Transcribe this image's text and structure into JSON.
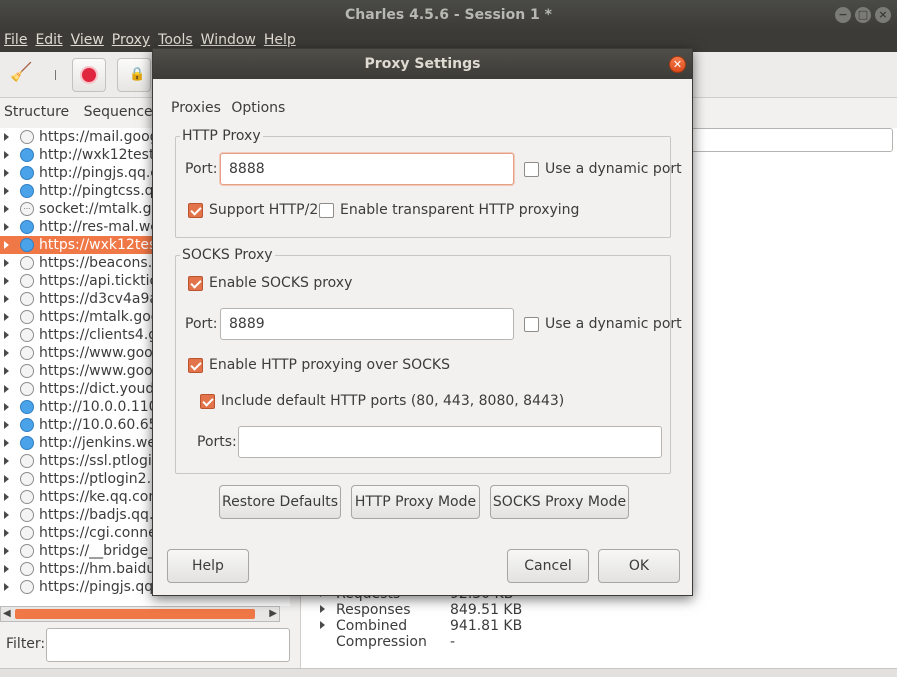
{
  "window": {
    "title": "Charles 4.5.6 - Session 1 *",
    "controls": {
      "minimize": "−",
      "maximize": "□",
      "close": "×"
    }
  },
  "menu": [
    "File",
    "Edit",
    "View",
    "Proxy",
    "Tools",
    "Window",
    "Help"
  ],
  "left_tabs": {
    "structure": "Structure",
    "sequence": "Sequence"
  },
  "tree": [
    {
      "label": "https://mail.google",
      "icon": "globe-icon"
    },
    {
      "label": "http://wxk12test.1",
      "icon": "globe-blue-icon"
    },
    {
      "label": "http://pingjs.qq.co",
      "icon": "globe-blue-icon"
    },
    {
      "label": "http://pingtcss.qq.",
      "icon": "globe-blue-icon"
    },
    {
      "label": "socket://mtalk.goo",
      "icon": "socket-icon"
    },
    {
      "label": "http://res-mal.wed",
      "icon": "globe-blue-icon"
    },
    {
      "label": "https://wxk12test.",
      "icon": "globe-blue-icon",
      "selected": true
    },
    {
      "label": "https://beacons.gc",
      "icon": "globe-icon"
    },
    {
      "label": "https://api.ticktick.c",
      "icon": "globe-icon"
    },
    {
      "label": "https://d3cv4a9a9",
      "icon": "globe-icon"
    },
    {
      "label": "https://mtalk.goog",
      "icon": "globe-icon"
    },
    {
      "label": "https://clients4.goo",
      "icon": "globe-icon"
    },
    {
      "label": "https://www.goog",
      "icon": "globe-icon"
    },
    {
      "label": "https://www.goog",
      "icon": "globe-icon"
    },
    {
      "label": "https://dict.youdac",
      "icon": "globe-icon"
    },
    {
      "label": "http://10.0.0.110:8",
      "icon": "globe-blue-icon"
    },
    {
      "label": "http://10.0.60.65:8",
      "icon": "globe-blue-icon"
    },
    {
      "label": "http://jenkins.weds",
      "icon": "globe-blue-icon"
    },
    {
      "label": "https://ssl.ptlogin2",
      "icon": "globe-icon"
    },
    {
      "label": "https://ptlogin2.ke",
      "icon": "globe-icon"
    },
    {
      "label": "https://ke.qq.com",
      "icon": "globe-icon"
    },
    {
      "label": "https://badjs.qq.co",
      "icon": "globe-icon"
    },
    {
      "label": "https://cgi.connect",
      "icon": "globe-icon"
    },
    {
      "label": "https://__bridge_lc",
      "icon": "globe-icon"
    },
    {
      "label": "https://hm.baidu.cc",
      "icon": "globe-icon"
    },
    {
      "label": "https://pingjs.qq.cc",
      "icon": "globe-icon"
    }
  ],
  "filter": {
    "label": "Filter:",
    "value": ""
  },
  "stats": [
    {
      "name": "Requests",
      "value": "92.30 KB"
    },
    {
      "name": "Responses",
      "value": "849.51 KB"
    },
    {
      "name": "Combined",
      "value": "941.81 KB"
    },
    {
      "name": "Compression",
      "value": "-"
    }
  ],
  "dialog": {
    "title": "Proxy Settings",
    "tabs": [
      "Proxies",
      "Options"
    ],
    "http_proxy": {
      "legend": "HTTP Proxy",
      "port_label": "Port:",
      "port_value": "8888",
      "dynamic_port_label": "Use a dynamic port",
      "dynamic_port_checked": false,
      "support_http2_label": "Support HTTP/2",
      "support_http2_checked": true,
      "transparent_label": "Enable transparent HTTP proxying",
      "transparent_checked": false
    },
    "socks_proxy": {
      "legend": "SOCKS Proxy",
      "enable_label": "Enable SOCKS proxy",
      "enable_checked": true,
      "port_label": "Port:",
      "port_value": "8889",
      "dynamic_port_label": "Use a dynamic port",
      "dynamic_port_checked": false,
      "http_over_socks_label": "Enable HTTP proxying over SOCKS",
      "http_over_socks_checked": true,
      "include_default_label": "Include default HTTP ports (80, 443, 8080, 8443)",
      "include_default_checked": true,
      "ports_label": "Ports:",
      "ports_value": ""
    },
    "buttons": {
      "restore_defaults": "Restore Defaults",
      "http_proxy_mode": "HTTP Proxy Mode",
      "socks_proxy_mode": "SOCKS Proxy Mode",
      "help": "Help",
      "cancel": "Cancel",
      "ok": "OK"
    }
  },
  "colors": {
    "accent": "#e2734a",
    "selection": "#f07746",
    "titlebar": "#3c3b37"
  }
}
